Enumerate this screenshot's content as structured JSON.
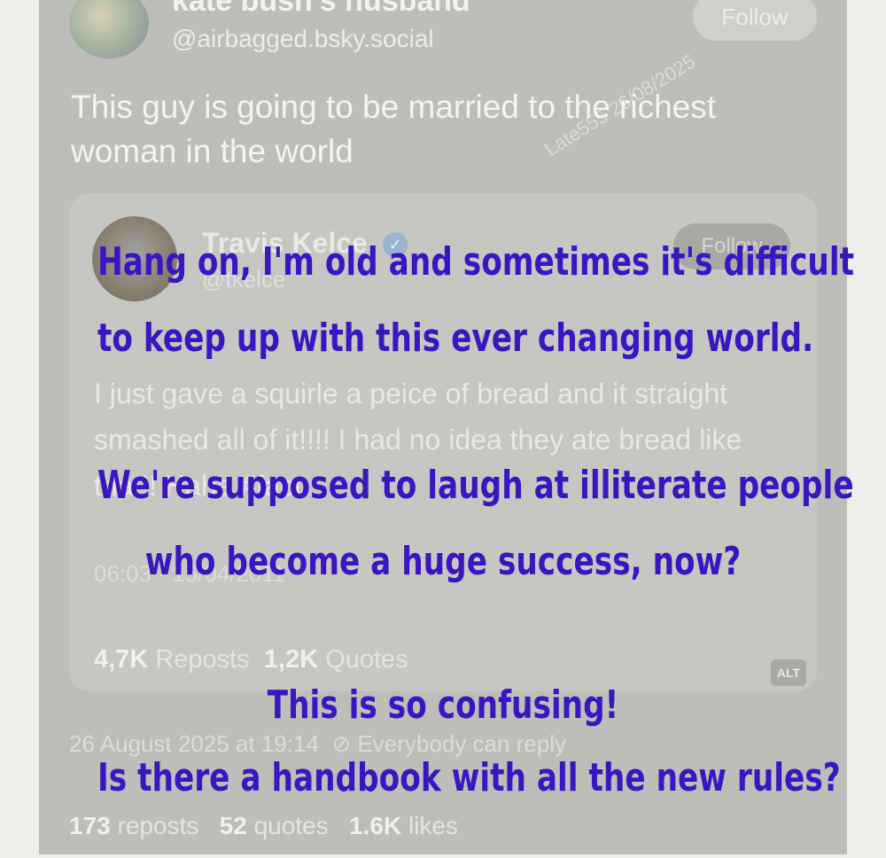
{
  "post": {
    "author_name": "kate bush's husband",
    "handle": "@airbagged.bsky.social",
    "follow_label": "Follow",
    "text": "This guy is going to be married to the richest woman in the world",
    "watermark": "Late555 26/08/2025",
    "timestamp": "26 August 2025 at 19:14",
    "reply_setting": "Everybody can reply",
    "stats": {
      "reposts_count": "173",
      "reposts_label": "reposts",
      "quotes_count": "52",
      "quotes_label": "quotes",
      "likes_count": "1.6K",
      "likes_label": "likes"
    }
  },
  "quoted": {
    "author_name": "Travis Kelce",
    "verified_glyph": "✓",
    "handle": "@tkelce",
    "follow_label": "Follow",
    "text": "I just gave a squirle a peice of bread and it straight smashed all of it!!!! I had no idea they ate bread like that!! Haha #fact",
    "timestamp": "06:03 · 15/04/2011",
    "stats": {
      "reposts_count": "4,7K",
      "reposts_label": "Reposts",
      "quotes_count": "1,2K",
      "quotes_label": "Quotes"
    },
    "alt_label": "ALT"
  },
  "overlay": {
    "line1": "Hang on, I'm old and sometimes it's difficult",
    "line2": "to keep up with this ever changing world.",
    "line3": "We're supposed to laugh at illiterate people",
    "line4": "who become a huge success, now?",
    "line5": "This is so confusing!",
    "line6": "Is there a handbook with all the new rules?",
    "color": "#3a16c0"
  }
}
